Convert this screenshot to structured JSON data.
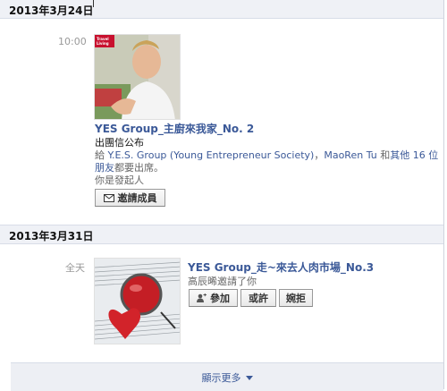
{
  "sections": [
    {
      "date": "2013年3月24日",
      "time": "10:00",
      "event_title": "YES Group_主廚來我家_No. 2",
      "line1": "出團信公布",
      "line2_prefix": "給 ",
      "line2_link": "Y.E.S. Group (Young Entrepreneur Society)",
      "line2_sep": "，",
      "line2_link2": "MaoRen Tu",
      "line2_mid": " 和",
      "line2_link3": "其他 16 位",
      "line3_link": "朋友",
      "line3_suffix": "都要出席。",
      "line4": "你是發起人",
      "invite_label": "邀請成員",
      "thumb_text": "Travel Living"
    },
    {
      "date": "2013年3月31日",
      "time": "全天",
      "event_title": "YES Group_走~來去人肉市場_No.3",
      "inviter_text": "高辰晞邀請了你",
      "join_label": "參加",
      "maybe_label": "或許",
      "decline_label": "婉拒"
    }
  ],
  "show_more_label": "顯示更多",
  "colors": {
    "link": "#3b5998",
    "header_bg": "#eff1f6"
  }
}
